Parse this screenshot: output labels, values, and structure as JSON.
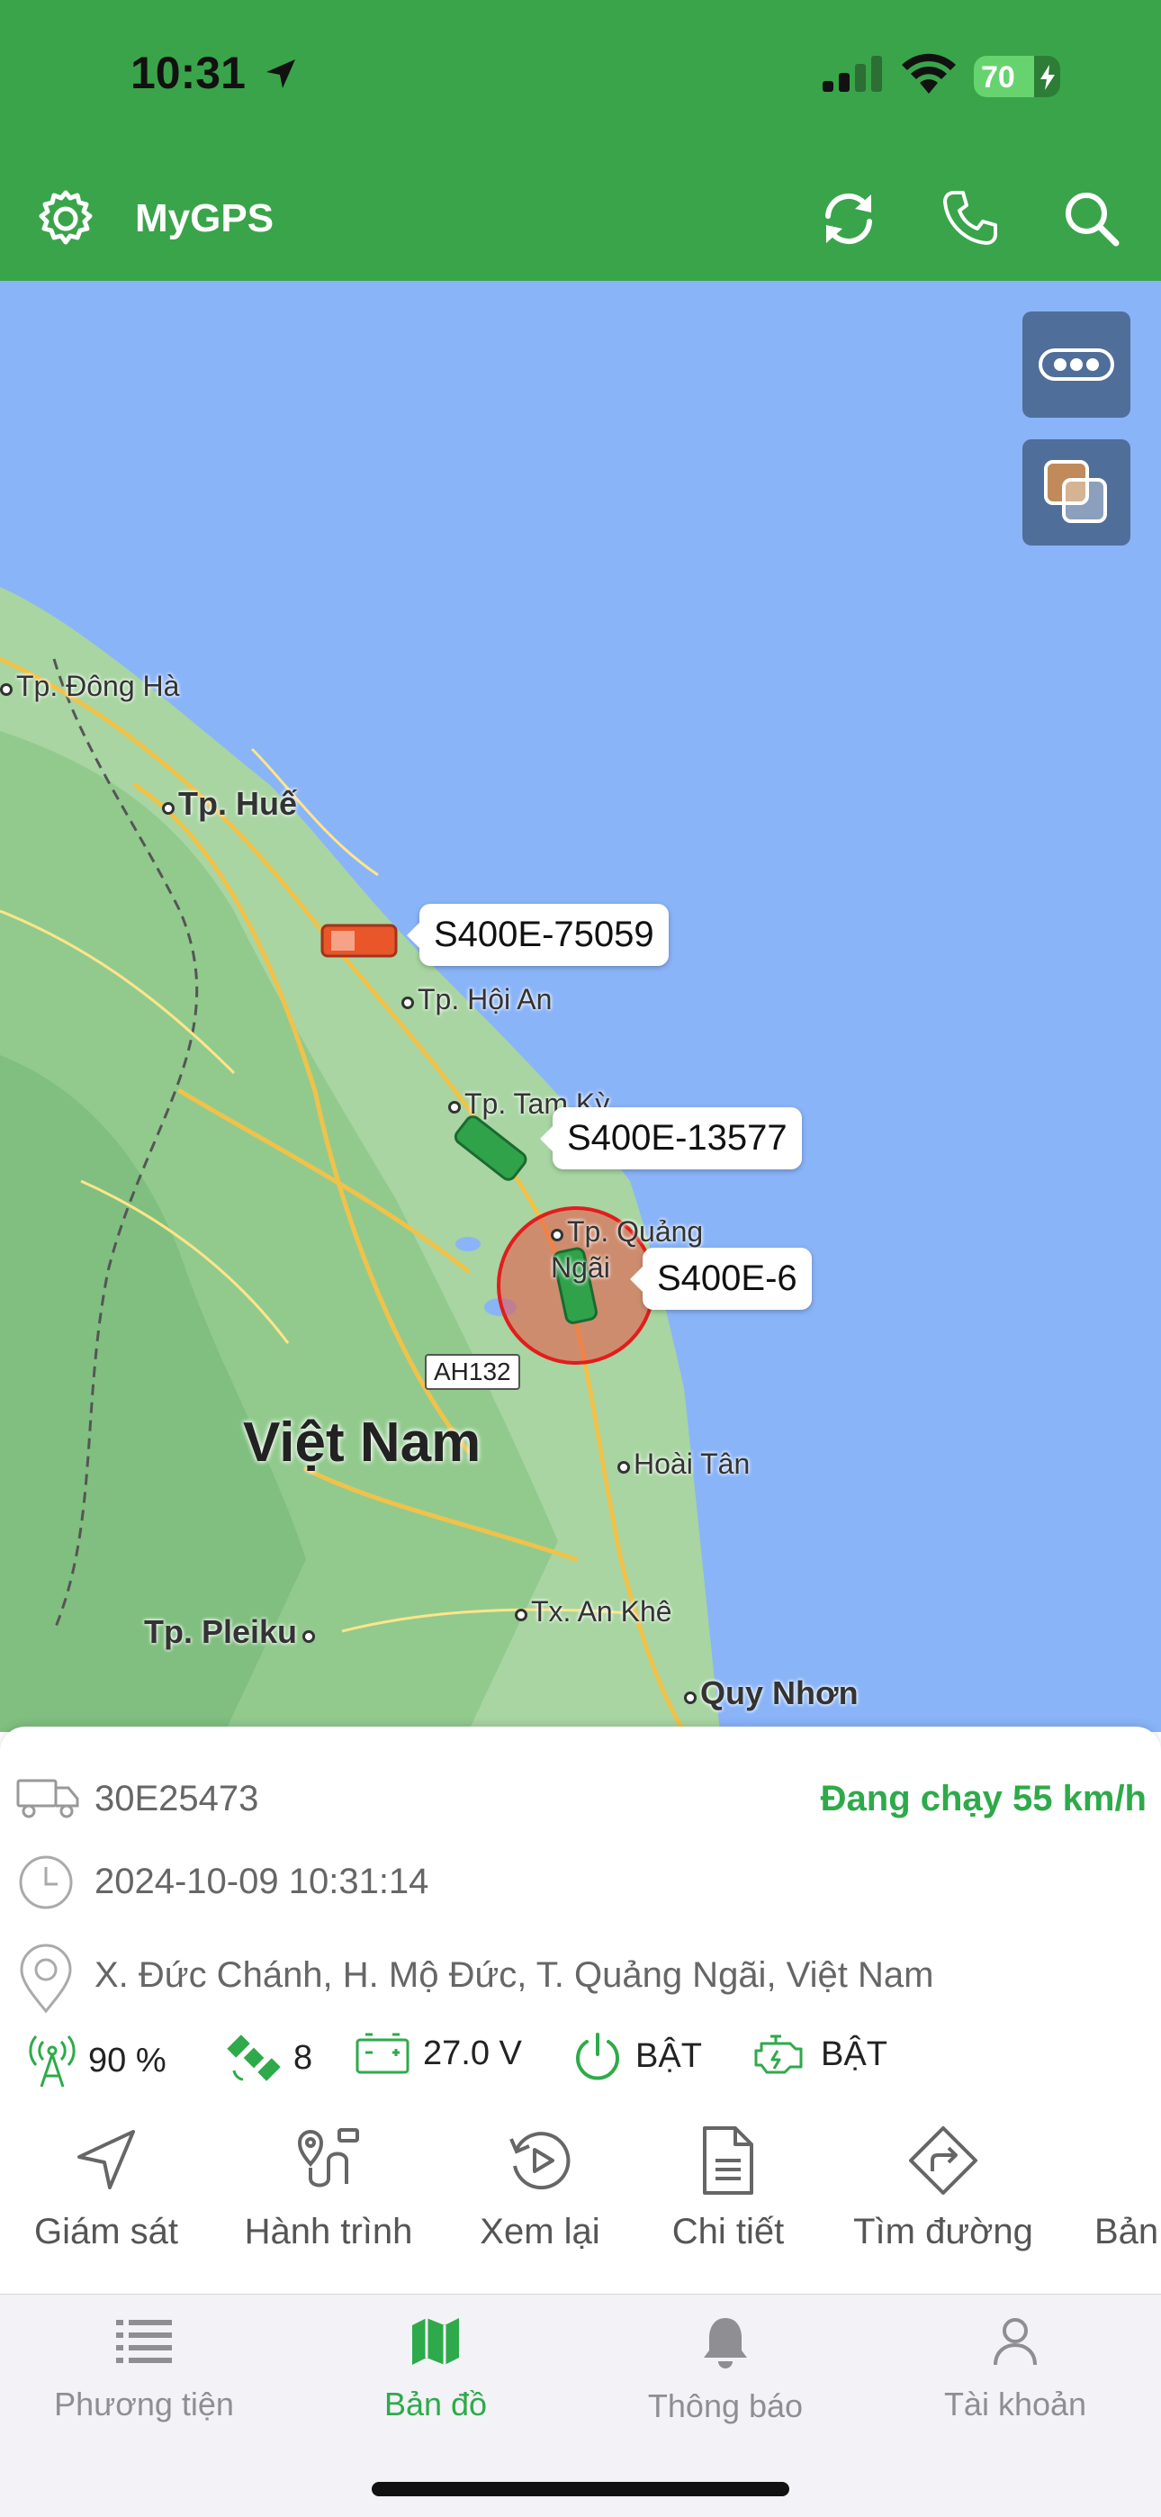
{
  "status_bar": {
    "time": "10:31",
    "battery": "70",
    "battery_fraction": 0.7
  },
  "header": {
    "title": "MyGPS"
  },
  "map": {
    "cities": [
      {
        "name": "Tp. Đông Hà",
        "bold": false
      },
      {
        "name": "Tp. Huế",
        "bold": true
      },
      {
        "name": "Tp. Hội An",
        "bold": false
      },
      {
        "name": "Tp. Tam Kỳ",
        "bold": false
      },
      {
        "name": "Tp. Quảng Ngãi",
        "bold": false
      },
      {
        "name": "Hoài Tân",
        "bold": false
      },
      {
        "name": "Tx. An Khê",
        "bold": false
      },
      {
        "name": "Tp. Pleiku",
        "bold": true
      },
      {
        "name": "Quy Nhơn",
        "bold": true
      }
    ],
    "country": "Việt Nam",
    "road_shield": "AH132",
    "vehicles": [
      {
        "id": "S400E-75059",
        "color": "#e8562a"
      },
      {
        "id": "S400E-13577",
        "color": "#2fa24a"
      },
      {
        "id": "S400E-6",
        "color": "#2fa24a"
      }
    ]
  },
  "panel": {
    "plate": "30E25473",
    "status": "Đang chạy 55 km/h",
    "datetime": "2024-10-09 10:31:14",
    "address": "X. Đức Chánh, H. Mộ Đức, T. Quảng Ngãi, Việt Nam",
    "metrics": {
      "signal": "90 %",
      "satellites": "8",
      "voltage": "27.0 V",
      "power": "BẬT",
      "engine": "BẬT"
    },
    "actions": [
      "Giám sát",
      "Hành trình",
      "Xem lại",
      "Chi tiết",
      "Tìm đường",
      "Bản"
    ]
  },
  "tabs": [
    {
      "label": "Phương tiện",
      "icon": "list-icon",
      "active": false
    },
    {
      "label": "Bản đồ",
      "icon": "map-icon",
      "active": true
    },
    {
      "label": "Thông báo",
      "icon": "bell-icon",
      "active": false
    },
    {
      "label": "Tài khoản",
      "icon": "user-icon",
      "active": false
    }
  ],
  "colors": {
    "brand": "#3aa44a",
    "accent": "#2eaa4a",
    "water": "#8ab4f8",
    "land": "#a8d5a2"
  }
}
